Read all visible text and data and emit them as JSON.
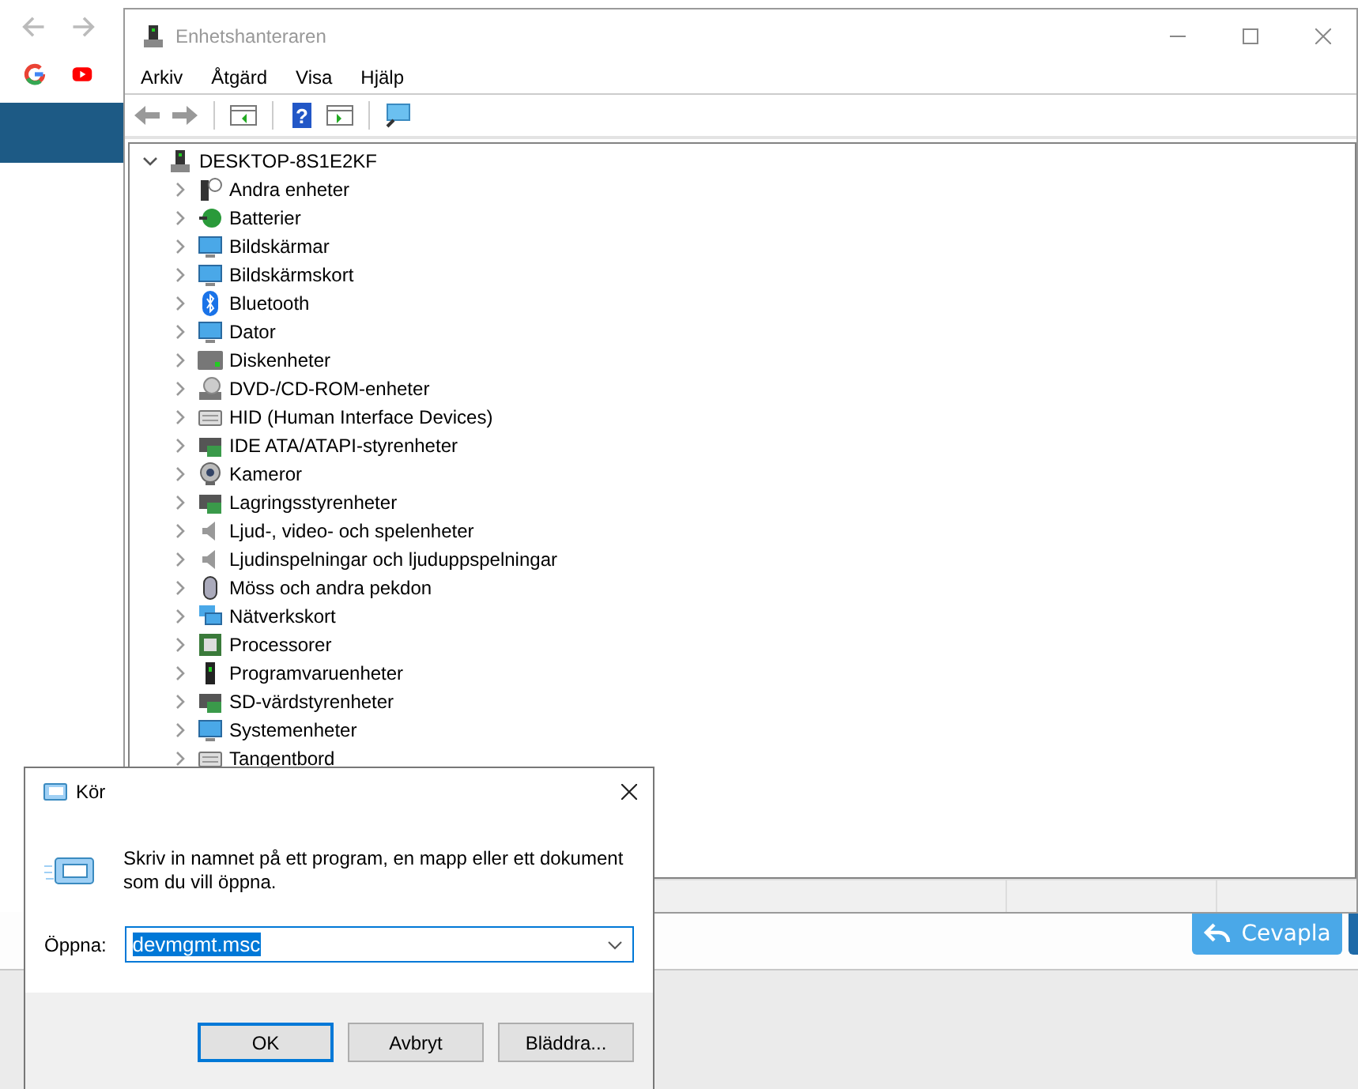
{
  "device_manager": {
    "title": "Enhetshanteraren",
    "menu": [
      "Arkiv",
      "Åtgärd",
      "Visa",
      "Hjälp"
    ],
    "help_glyph": "?",
    "tree": {
      "label": "DESKTOP-8S1E2KF",
      "expanded": true,
      "children": [
        {
          "label": "Andra enheter",
          "expanded": false
        },
        {
          "label": "Batterier",
          "expanded": false
        },
        {
          "label": "Bildskärmar",
          "expanded": false
        },
        {
          "label": "Bildskärmskort",
          "expanded": false
        },
        {
          "label": "Bluetooth",
          "expanded": false
        },
        {
          "label": "Dator",
          "expanded": false
        },
        {
          "label": "Diskenheter",
          "expanded": false
        },
        {
          "label": "DVD-/CD-ROM-enheter",
          "expanded": false
        },
        {
          "label": "HID (Human Interface Devices)",
          "expanded": false
        },
        {
          "label": "IDE ATA/ATAPI-styrenheter",
          "expanded": false
        },
        {
          "label": "Kameror",
          "expanded": false
        },
        {
          "label": "Lagringsstyrenheter",
          "expanded": false
        },
        {
          "label": "Ljud-, video- och spelenheter",
          "expanded": false
        },
        {
          "label": "Ljudinspelningar och ljuduppspelningar",
          "expanded": false
        },
        {
          "label": "Möss och andra pekdon",
          "expanded": false
        },
        {
          "label": "Nätverkskort",
          "expanded": false
        },
        {
          "label": "Processorer",
          "expanded": false
        },
        {
          "label": "Programvaruenheter",
          "expanded": false
        },
        {
          "label": "SD-värdstyrenheter",
          "expanded": false
        },
        {
          "label": "Systemenheter",
          "expanded": false
        },
        {
          "label": "Tangentbord",
          "expanded": false
        }
      ]
    }
  },
  "reply_button": "Cevapla",
  "run_dialog": {
    "title": "Kör",
    "description": "Skriv in namnet på ett program, en mapp eller ett dokument som du vill öppna.",
    "field_label": "Öppna:",
    "value": "devmgmt.msc",
    "buttons": [
      {
        "label": "OK",
        "selected": true
      },
      {
        "label": "Avbryt",
        "selected": false
      },
      {
        "label": "Bläddra...",
        "selected": false
      }
    ]
  }
}
